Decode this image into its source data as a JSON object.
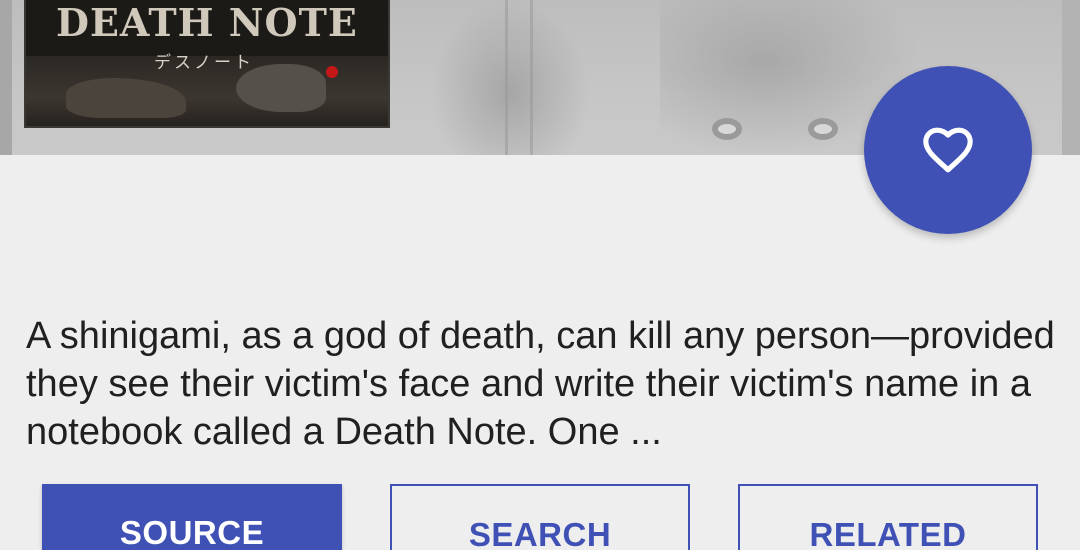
{
  "header": {
    "cover": {
      "logo_text": "DEATH NOTE",
      "logo_subtitle": "デスノート"
    }
  },
  "favorite_button": {
    "icon": "heart-outline-icon",
    "color": "#3f51b5"
  },
  "description": {
    "text": "A shinigami, as a god of death, can kill any person—provided they see their victim's face and write their victim's name in a notebook called a Death Note. One ..."
  },
  "actions": {
    "source_label": "SOURCE",
    "search_label": "SEARCH",
    "related_label": "RELATED"
  },
  "colors": {
    "accent": "#3f51b5",
    "background": "#eeeeee",
    "text": "#202020"
  }
}
